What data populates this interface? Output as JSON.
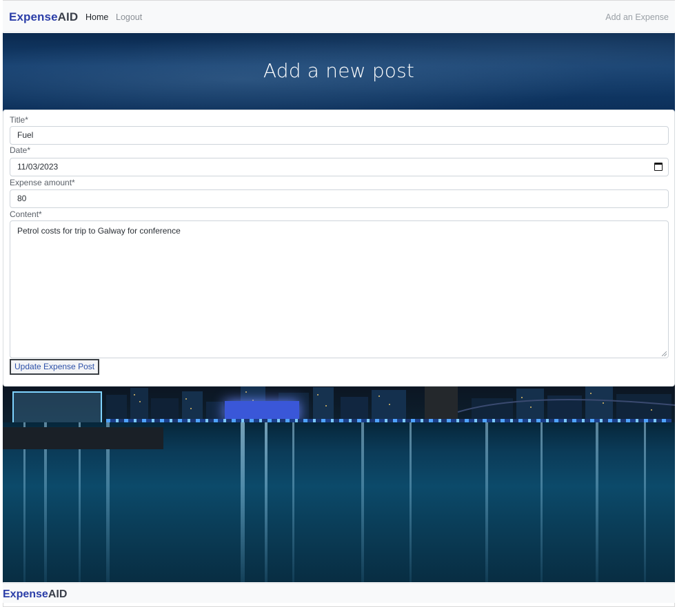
{
  "navbar": {
    "brand_part1": "Expense",
    "brand_part2": "AID",
    "links": [
      {
        "label": "Home"
      },
      {
        "label": "Logout"
      }
    ],
    "right_link": "Add an Expense"
  },
  "hero": {
    "title": "Add a new post"
  },
  "form": {
    "title": {
      "label": "Title*",
      "value": "Fuel"
    },
    "date": {
      "label": "Date*",
      "value": "11/03/2023",
      "icon": "calendar-icon"
    },
    "amount": {
      "label": "Expense amount*",
      "value": "80"
    },
    "content": {
      "label": "Content*",
      "value": "Petrol costs for trip to Galway for conference"
    },
    "submit_label": "Update Expense Post"
  },
  "footer": {
    "brand_part1": "Expense",
    "brand_part2": "AID"
  },
  "colors": {
    "brand_blue": "#2b3ea8",
    "brand_dark": "#3a3f4a",
    "navbar_bg": "#f8f9fa",
    "button_text": "#2b4fa8"
  }
}
